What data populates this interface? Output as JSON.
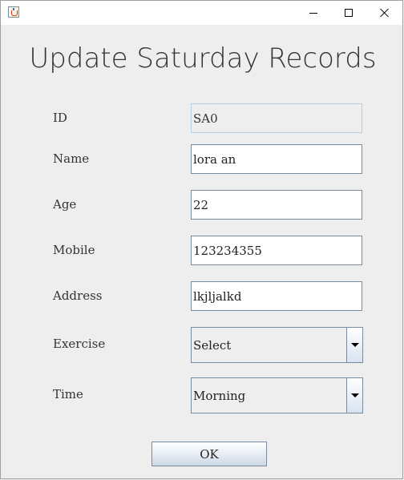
{
  "window": {
    "title": "",
    "controls": {
      "minimize_icon": "minimize-icon",
      "maximize_icon": "maximize-icon",
      "close_icon": "close-icon"
    }
  },
  "form": {
    "heading": "Update Saturday Records",
    "fields": [
      {
        "label": "ID",
        "value": "SA0",
        "editable": false
      },
      {
        "label": "Name",
        "value": "lora an"
      },
      {
        "label": "Age",
        "value": "22"
      },
      {
        "label": "Mobile",
        "value": "123234355"
      },
      {
        "label": "Address",
        "value": "lkjljalkd"
      }
    ],
    "exercise": {
      "label": "Exercise",
      "selected": "Select"
    },
    "time": {
      "label": "Time",
      "selected": "Morning"
    },
    "ok_label": "OK"
  },
  "colors": {
    "background": "#eeeeee",
    "field_border": "#7a8a9a",
    "readonly_border": "#b8cfe0"
  }
}
